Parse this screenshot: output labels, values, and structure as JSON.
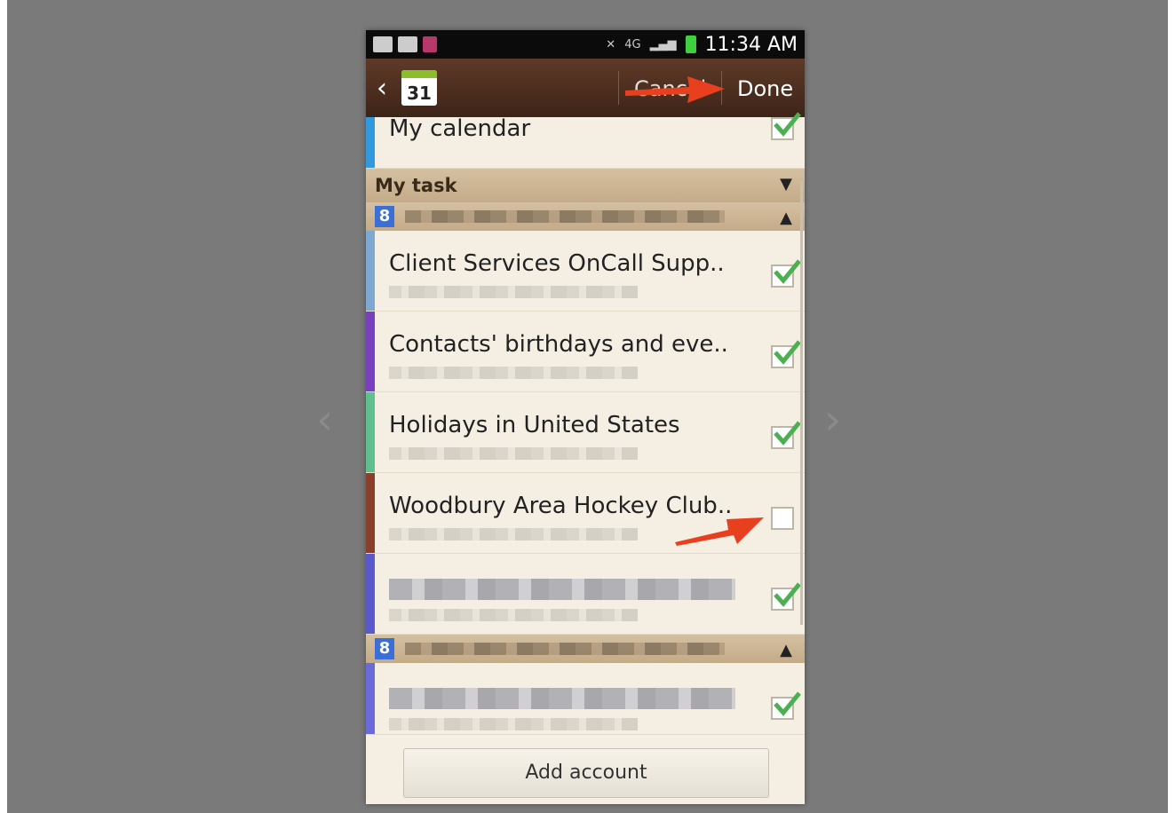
{
  "status_bar": {
    "network": "4G",
    "time": "11:34 AM",
    "icons": [
      "gallery-icon",
      "gmail-icon",
      "tmobile-icon",
      "mute-icon",
      "signal-icon",
      "battery-icon"
    ]
  },
  "action_bar": {
    "calendar_day": "31",
    "cancel_label": "Cancel",
    "done_label": "Done"
  },
  "calendars": {
    "top_item": {
      "title": "My calendar",
      "checked": true,
      "color": "#3399dd"
    },
    "task_section_title": "My task",
    "account1_items": [
      {
        "title": "Client Services OnCall Supp..",
        "checked": true,
        "color": "#7fa8d0"
      },
      {
        "title": "Contacts' birthdays and eve..",
        "checked": true,
        "color": "#7a3fbf"
      },
      {
        "title": "Holidays in United States",
        "checked": true,
        "color": "#5fbf8f"
      },
      {
        "title": "Woodbury Area Hockey Club..",
        "checked": false,
        "color": "#8b3f2a"
      },
      {
        "title": "",
        "checked": true,
        "color": "#5a5acc"
      }
    ],
    "account2_items": [
      {
        "title": "",
        "checked": true,
        "color": "#6a6ad8"
      }
    ]
  },
  "add_account_label": "Add account",
  "colors": {
    "accent_check": "#4caf50",
    "annotation_arrow": "#e8401f"
  }
}
